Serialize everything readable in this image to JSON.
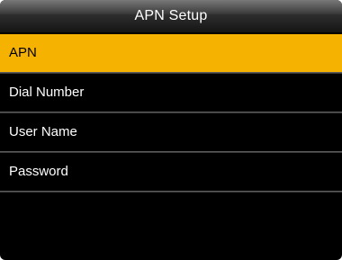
{
  "header": {
    "title": "APN Setup"
  },
  "menu": {
    "items": [
      {
        "label": "APN",
        "selected": true
      },
      {
        "label": "Dial Number",
        "selected": false
      },
      {
        "label": "User Name",
        "selected": false
      },
      {
        "label": "Password",
        "selected": false
      }
    ]
  },
  "colors": {
    "selected_background": "#f5b200",
    "screen_background": "#000000",
    "text": "#ffffff",
    "selected_text": "#000000"
  }
}
